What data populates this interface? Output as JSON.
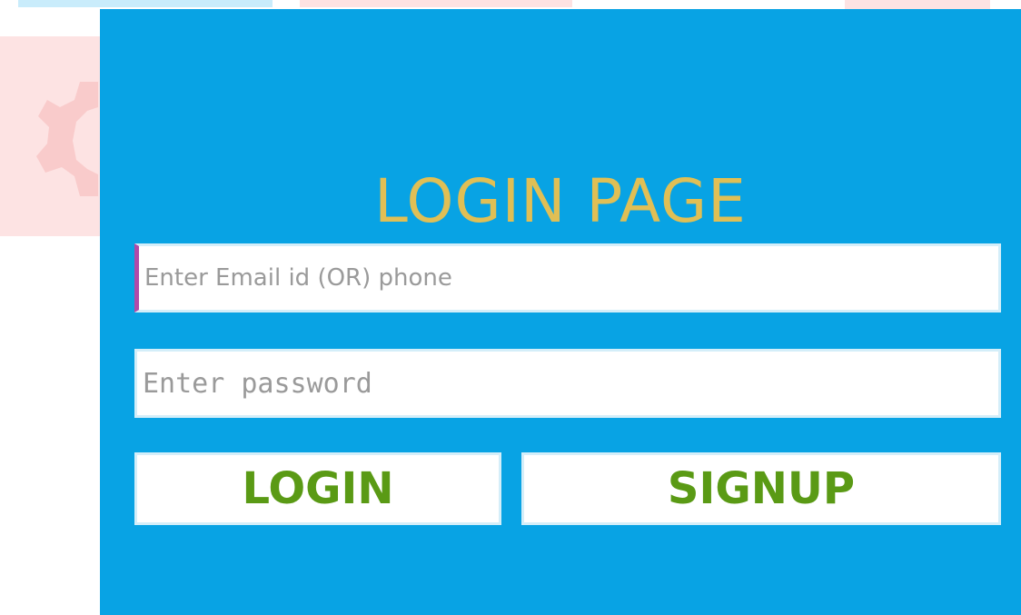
{
  "login_panel": {
    "title": "LOGIN PAGE",
    "email_field": {
      "placeholder": "Enter Email id (OR) phone",
      "value": ""
    },
    "password_field": {
      "placeholder": "Enter password",
      "value": ""
    },
    "login_button_label": "LOGIN",
    "signup_button_label": "SIGNUP"
  },
  "colors": {
    "panel_background": "#08a3e4",
    "title": "#e0bf55",
    "button_text": "#5a9a15",
    "field_background": "#ffffff"
  },
  "icons": {
    "background_decoration": "gear-icon"
  }
}
